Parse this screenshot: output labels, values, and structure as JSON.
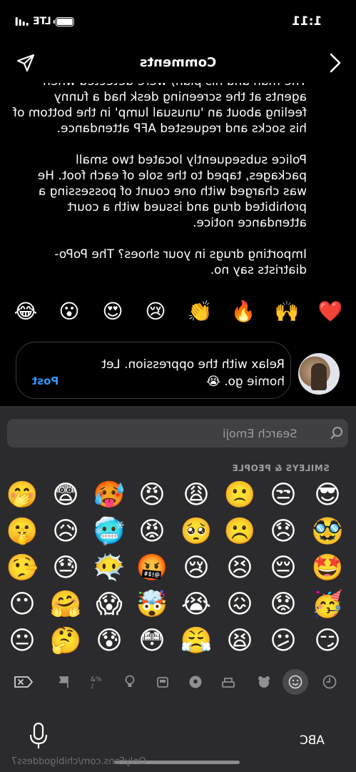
{
  "status_bar": {
    "time": "1:11",
    "network": "LTE"
  },
  "header": {
    "title": "Comments"
  },
  "comment": {
    "paragraph_1": "The man and his plan) were detected when agents at the screening desk had a funny feeling about an 'unusual lump' in the bottom of his socks and requested AFP attendance.",
    "paragraph_2": "Police subsequently located two small packages, taped to the sole of each foot. He was charged with one count of possessing a prohibited drug and issued with a court attendance notice.",
    "paragraph_3": "Importing drugs in your shoes? The PoPo-diatrists say no."
  },
  "quick_reactions": [
    "❤️",
    "🙌",
    "🔥",
    "👏",
    "😢",
    "😍",
    "😮",
    "😂"
  ],
  "composer": {
    "text": "Relax with the oppression. Let homie go. 😭",
    "post_label": "Post"
  },
  "keyboard": {
    "search_placeholder": "Search Emoji",
    "section_label": "SMILEYS & PEOPLE",
    "emoji_rows": [
      [
        "😎",
        "😒",
        "🙁",
        "😩",
        "😠",
        "🥵",
        "😨",
        "🤭"
      ],
      [
        "🥸",
        "😞",
        "☹️",
        "🥺",
        "😡",
        "🥶",
        "😥",
        "🤫"
      ],
      [
        "🤩",
        "😔",
        "😣",
        "😢",
        "🤬",
        "😶‍🌫️",
        "😓",
        "🤥"
      ],
      [
        "🥳",
        "😟",
        "😖",
        "😭",
        "🤯",
        "😱",
        "🤗",
        "😶"
      ],
      [
        "😏",
        "😕",
        "😫",
        "😤",
        "😳",
        "😰",
        "🤔",
        "😐"
      ]
    ],
    "abc_label": "ABC",
    "watermark": "OnlyFans.com/chibigoddess7"
  },
  "colors": {
    "accent": "#2f95f6",
    "keyboard_bg": "#2b2b2d"
  }
}
